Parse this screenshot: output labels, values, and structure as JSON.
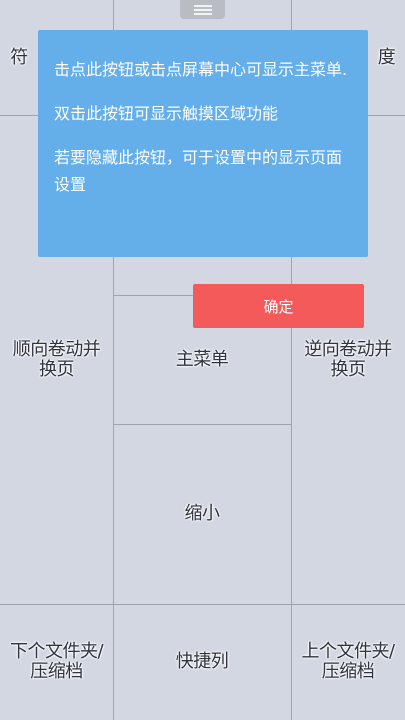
{
  "zones": {
    "top_left": "符",
    "top_right": "度",
    "scroll_forward": "顺向卷动并\n换页",
    "main_menu": "主菜单",
    "scroll_backward": "逆向卷动并\n换页",
    "zoom_out": "缩小",
    "next_folder": "下个文件夹/\n压缩档",
    "shortcut_bar": "快捷列",
    "prev_folder": "上个文件夹/\n压缩档"
  },
  "tooltip": {
    "line1": "击点此按钮或击点屏幕中心可显示主菜单.",
    "line2": "双击此按钮可显示触摸区域功能",
    "line3": "若要隐藏此按钮，可于设置中的显示页面设置"
  },
  "confirm_label": "确定",
  "colors": {
    "tooltip_bg": "#64aeea",
    "confirm_bg": "#f45a5a",
    "zone_bg": "#d2d7e1"
  }
}
